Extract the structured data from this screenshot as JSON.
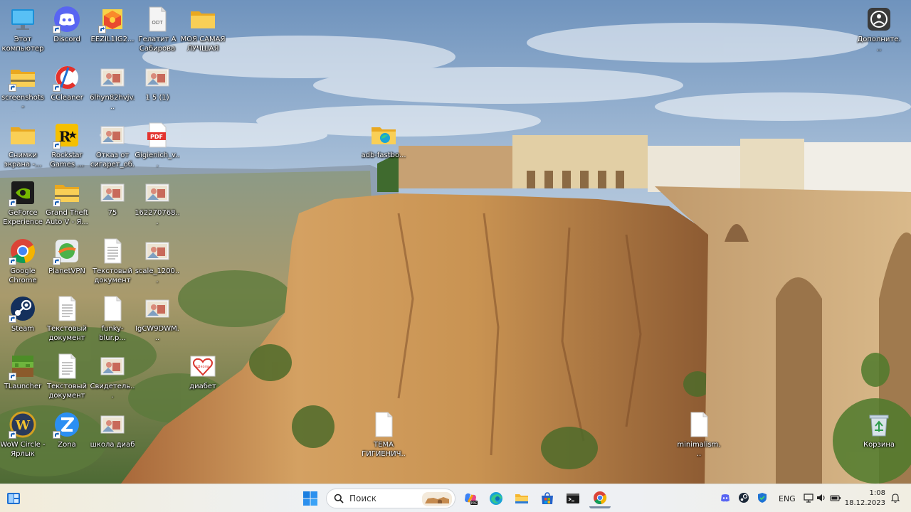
{
  "desktop": {
    "icons": [
      {
        "name": "this-pc",
        "label": "Этот\nкомпьютер",
        "icon": "monitor-icon"
      },
      {
        "name": "discord",
        "label": "Discord",
        "icon": "discord-icon"
      },
      {
        "name": "eezu",
        "label": "EEZIL1IG2...",
        "icon": "cube-app-icon"
      },
      {
        "name": "odt-file",
        "label": "Гелатит А\nСабирова",
        "icon": "odt-document-icon"
      },
      {
        "name": "folder-moya",
        "label": "МОЯ САМАЯ\nЛУЧШАЯ Ж...",
        "icon": "folder-icon"
      },
      {
        "name": "screenshots-shortcut",
        "label": "screenshots -\nЯрлык",
        "icon": "folder-shortcut-icon"
      },
      {
        "name": "ccleaner",
        "label": "CCleaner",
        "icon": "ccleaner-icon"
      },
      {
        "name": "6lhyn",
        "label": "6lhyn82hvjv...",
        "icon": "image-file-icon"
      },
      {
        "name": "file-15",
        "label": "1 5 (1)",
        "icon": "image-file-icon"
      },
      {
        "name": "screen-snips",
        "label": "Снимки\nэкрана -...",
        "icon": "folder-icon"
      },
      {
        "name": "rockstar",
        "label": "Rockstar\nGames ...",
        "icon": "rockstar-icon"
      },
      {
        "name": "otkaz",
        "label": "Отказ от\nсигарет_об...",
        "icon": "image-file-icon"
      },
      {
        "name": "pdf-file",
        "label": "Gigienich_v...",
        "icon": "pdf-icon"
      },
      {
        "name": "adb-fastboot",
        "label": "adb-fastbo...",
        "icon": "folder-edge-icon"
      },
      {
        "name": "geforce",
        "label": "GeForce\nExperience",
        "icon": "nvidia-icon"
      },
      {
        "name": "gta5",
        "label": "Grand Theft\nAuto V - Я...",
        "icon": "folder-shortcut-icon"
      },
      {
        "name": "img-75",
        "label": "75",
        "icon": "image-file-icon"
      },
      {
        "name": "img-1622",
        "label": "162270768...",
        "icon": "image-file-icon"
      },
      {
        "name": "chrome",
        "label": "Google\nChrome",
        "icon": "chrome-icon"
      },
      {
        "name": "planetvpn",
        "label": "PlanetVPN",
        "icon": "planetvpn-icon"
      },
      {
        "name": "txt-3",
        "label": "Текстовый\nдокумент (3)",
        "icon": "text-document-icon"
      },
      {
        "name": "scale-1200",
        "label": "scale_1200...",
        "icon": "image-file-icon"
      },
      {
        "name": "steam",
        "label": "Steam",
        "icon": "steam-icon"
      },
      {
        "name": "txt-2",
        "label": "Текстовый\nдокумент (2)",
        "icon": "text-document-icon"
      },
      {
        "name": "funky-blur",
        "label": "funky-blur.p...",
        "icon": "blank-document-icon"
      },
      {
        "name": "igcw",
        "label": "IgCW9DWM...",
        "icon": "image-file-icon"
      },
      {
        "name": "tlauncher",
        "label": "TLauncher",
        "icon": "tlauncher-icon"
      },
      {
        "name": "txt-1",
        "label": "Текстовый\nдокумент",
        "icon": "text-document-icon"
      },
      {
        "name": "svidetel",
        "label": "Свидетель...",
        "icon": "image-file-icon"
      },
      {
        "name": "diabet",
        "label": "диабет",
        "icon": "heart-image-icon"
      },
      {
        "name": "tema",
        "label": "ТЕМА\nГИГИЕНИЧ...",
        "icon": "blank-document-icon"
      },
      {
        "name": "minimalism",
        "label": "minimalism...",
        "icon": "blank-document-icon"
      },
      {
        "name": "wow-circle",
        "label": "WoW Circle -\nЯрлык",
        "icon": "wow-icon"
      },
      {
        "name": "zona",
        "label": "Zona",
        "icon": "zona-icon"
      },
      {
        "name": "shkola",
        "label": "школа диаб",
        "icon": "image-file-icon"
      },
      {
        "name": "recycle-bin",
        "label": "Корзина",
        "icon": "recycle-bin-icon"
      },
      {
        "name": "more-info",
        "label": "Дополните...\nсведения о...",
        "icon": "info-circle-icon"
      }
    ]
  },
  "taskbar": {
    "search_placeholder": "Поиск",
    "language": "ENG",
    "time": "1:08",
    "date": "18.12.2023"
  }
}
